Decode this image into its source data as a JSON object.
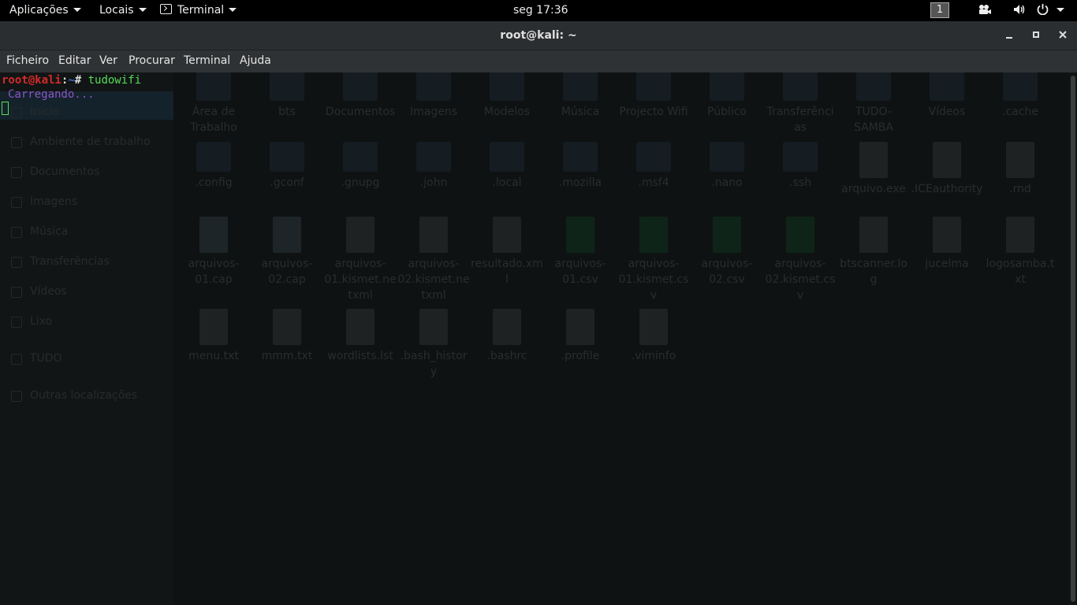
{
  "topbar": {
    "apps": "Aplicações",
    "places": "Locais",
    "terminal_menu": "Terminal",
    "clock": "seg 17:36",
    "workspace": "1"
  },
  "window": {
    "title": "root@kali: ~",
    "menu": [
      "Ficheiro",
      "Editar",
      "Ver",
      "Procurar",
      "Terminal",
      "Ajuda"
    ]
  },
  "terminal": {
    "user": "root@kali",
    "sep": ":",
    "path": "~",
    "prompt_char": "# ",
    "command": "tudowifi",
    "output": "Carregando..."
  },
  "background_filemanager": {
    "sidebar": [
      {
        "label": "Início",
        "icon": "home-icon"
      },
      {
        "label": "Ambiente de trabalho",
        "icon": "folder-icon"
      },
      {
        "label": "Documentos",
        "icon": "document-icon"
      },
      {
        "label": "Imagens",
        "icon": "image-icon"
      },
      {
        "label": "Música",
        "icon": "music-icon"
      },
      {
        "label": "Transferências",
        "icon": "download-icon"
      },
      {
        "label": "Vídeos",
        "icon": "video-icon"
      },
      {
        "label": "Lixo",
        "icon": "trash-icon"
      },
      {
        "label": "TUDO",
        "icon": "drive-icon"
      },
      {
        "label": "Outras localizações",
        "icon": "plus-icon"
      }
    ],
    "files": [
      {
        "name": "Área de Trabalho",
        "kind": "desktop"
      },
      {
        "name": "bts",
        "kind": "folder"
      },
      {
        "name": "Documentos",
        "kind": "folder"
      },
      {
        "name": "Imagens",
        "kind": "folder"
      },
      {
        "name": "Modelos",
        "kind": "folder"
      },
      {
        "name": "Música",
        "kind": "folder"
      },
      {
        "name": "Projecto Wifi",
        "kind": "folder"
      },
      {
        "name": "Público",
        "kind": "folder"
      },
      {
        "name": "Transferências",
        "kind": "folder"
      },
      {
        "name": "TUDO-SAMBA",
        "kind": "folder"
      },
      {
        "name": "Vídeos",
        "kind": "folder"
      },
      {
        "name": ".cache",
        "kind": "folder"
      },
      {
        "name": ".config",
        "kind": "folder"
      },
      {
        "name": ".gconf",
        "kind": "folder"
      },
      {
        "name": ".gnupg",
        "kind": "folder"
      },
      {
        "name": ".john",
        "kind": "folder"
      },
      {
        "name": ".local",
        "kind": "folder"
      },
      {
        "name": ".mozilla",
        "kind": "folder"
      },
      {
        "name": ".msf4",
        "kind": "folder"
      },
      {
        "name": ".nano",
        "kind": "folder"
      },
      {
        "name": ".ssh",
        "kind": "folder"
      },
      {
        "name": "arquivo.exe",
        "kind": "file"
      },
      {
        "name": ".ICEauthority",
        "kind": "file"
      },
      {
        "name": ".rnd",
        "kind": "file"
      },
      {
        "name": "arquivos-01.cap",
        "kind": "cap"
      },
      {
        "name": "arquivos-02.cap",
        "kind": "cap"
      },
      {
        "name": "arquivos-01.kismet.netxml",
        "kind": "file"
      },
      {
        "name": "arquivos-02.kismet.netxml",
        "kind": "file"
      },
      {
        "name": "resultado.xml",
        "kind": "file"
      },
      {
        "name": "arquivos-01.csv",
        "kind": "sheet"
      },
      {
        "name": "arquivos-01.kismet.csv",
        "kind": "sheet"
      },
      {
        "name": "arquivos-02.csv",
        "kind": "sheet"
      },
      {
        "name": "arquivos-02.kismet.csv",
        "kind": "sheet"
      },
      {
        "name": "btscanner.log",
        "kind": "file"
      },
      {
        "name": "jucelma",
        "kind": "file"
      },
      {
        "name": "logosamba.txt",
        "kind": "file"
      },
      {
        "name": "menu.txt",
        "kind": "file"
      },
      {
        "name": "mmm.txt",
        "kind": "file"
      },
      {
        "name": "wordlists.lst",
        "kind": "file"
      },
      {
        "name": ".bash_history",
        "kind": "file"
      },
      {
        "name": ".bashrc",
        "kind": "file"
      },
      {
        "name": ".profile",
        "kind": "file"
      },
      {
        "name": ".viminfo",
        "kind": "file"
      }
    ]
  }
}
